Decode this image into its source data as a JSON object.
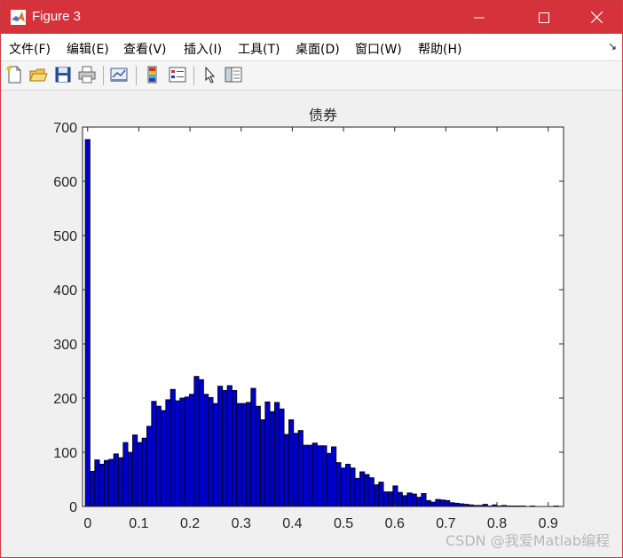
{
  "window": {
    "title": "Figure 3",
    "minimize_icon": "minimize-icon",
    "maximize_icon": "maximize-icon",
    "close_icon": "close-icon"
  },
  "menu": {
    "items": [
      "文件(F)",
      "编辑(E)",
      "查看(V)",
      "插入(I)",
      "工具(T)",
      "桌面(D)",
      "窗口(W)",
      "帮助(H)"
    ],
    "dock_arrow": "↘"
  },
  "toolbar": {
    "icons": [
      "new-figure-icon",
      "open-icon",
      "save-icon",
      "print-icon",
      "link-plot-icon",
      "colorbar-icon",
      "legend-icon",
      "pointer-icon",
      "property-editor-icon"
    ]
  },
  "watermark": "CSDN @我爱Matlab编程",
  "colors": {
    "titlebar": "#d5323b",
    "bar_fill": "#0000cd",
    "bar_edge": "#000000"
  },
  "chart_data": {
    "type": "bar",
    "title": "债券",
    "xlabel": "",
    "ylabel": "",
    "xlim": [
      -0.01,
      0.93
    ],
    "ylim": [
      0,
      700
    ],
    "xticks": [
      0,
      0.1,
      0.2,
      0.3,
      0.4,
      0.5,
      0.6,
      0.7,
      0.8,
      0.9
    ],
    "xtick_labels": [
      "0",
      "0.1",
      "0.2",
      "0.3",
      "0.4",
      "0.5",
      "0.6",
      "0.7",
      "0.8",
      "0.9"
    ],
    "yticks": [
      0,
      100,
      200,
      300,
      400,
      500,
      600,
      700
    ],
    "ytick_labels": [
      "0",
      "100",
      "200",
      "300",
      "400",
      "500",
      "600",
      "700"
    ],
    "grid": false,
    "bin_width": 0.00925,
    "x": [
      0.0,
      0.00925,
      0.0185,
      0.02775,
      0.037,
      0.04625,
      0.0555,
      0.06475,
      0.074,
      0.08325,
      0.0925,
      0.10175,
      0.111,
      0.12025,
      0.1295,
      0.13875,
      0.148,
      0.15725,
      0.1665,
      0.17575,
      0.185,
      0.19425,
      0.2035,
      0.21275,
      0.222,
      0.23125,
      0.2405,
      0.24975,
      0.259,
      0.26825,
      0.2775,
      0.28675,
      0.296,
      0.30525,
      0.3145,
      0.32375,
      0.333,
      0.34225,
      0.3515,
      0.36075,
      0.37,
      0.37925,
      0.3885,
      0.39775,
      0.407,
      0.41625,
      0.4255,
      0.43475,
      0.444,
      0.45325,
      0.4625,
      0.47175,
      0.481,
      0.49025,
      0.4995,
      0.50875,
      0.518,
      0.52725,
      0.5365,
      0.54575,
      0.555,
      0.56425,
      0.5735,
      0.58275,
      0.592,
      0.60125,
      0.6105,
      0.61975,
      0.629,
      0.63825,
      0.6475,
      0.65675,
      0.666,
      0.67525,
      0.6845,
      0.69375,
      0.703,
      0.71225,
      0.7215,
      0.73075,
      0.74,
      0.74925,
      0.7585,
      0.76775,
      0.777,
      0.78625,
      0.7955,
      0.80475,
      0.814,
      0.82325,
      0.8325,
      0.84175,
      0.851,
      0.86025,
      0.8695,
      0.87875,
      0.888,
      0.89725,
      0.9065,
      0.91575
    ],
    "values": [
      677,
      65,
      86,
      78,
      85,
      87,
      97,
      90,
      118,
      100,
      132,
      118,
      126,
      148,
      194,
      185,
      177,
      197,
      216,
      195,
      200,
      202,
      207,
      240,
      234,
      207,
      201,
      190,
      222,
      214,
      223,
      214,
      190,
      190,
      192,
      218,
      185,
      160,
      193,
      175,
      192,
      180,
      133,
      160,
      135,
      140,
      113,
      113,
      117,
      112,
      112,
      98,
      110,
      81,
      71,
      78,
      71,
      52,
      64,
      59,
      53,
      40,
      45,
      27,
      27,
      38,
      26,
      20,
      25,
      23,
      17,
      24,
      11,
      8,
      13,
      12,
      11,
      7,
      6,
      5,
      4,
      3,
      2,
      2,
      4,
      1,
      3,
      1,
      2,
      1,
      1,
      1,
      1,
      0,
      1,
      0,
      0,
      0,
      0,
      1
    ]
  }
}
